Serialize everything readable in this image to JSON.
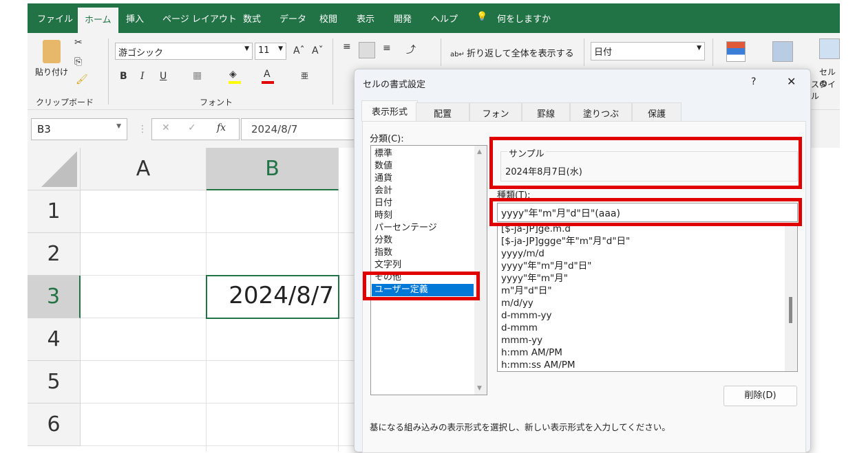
{
  "ribbon_tabs": [
    "ファイル",
    "ホーム",
    "挿入",
    "ページ レイアウト",
    "数式",
    "データ",
    "校閲",
    "表示",
    "開発",
    "ヘルプ"
  ],
  "active_tab": "ホーム",
  "tell_me": "何をしますか",
  "clipboard": {
    "paste": "貼り付け",
    "group": "クリップボード"
  },
  "font": {
    "name": "游ゴシック",
    "size": "11",
    "group": "フォント",
    "bold": "B",
    "italic": "I",
    "underline": "U",
    "font_color_letter": "A",
    "fill_color": "#ffff00",
    "font_color": "#e00000"
  },
  "alignment": {
    "wrap_text": "折り返して全体を表示する"
  },
  "number": {
    "format": "日付"
  },
  "styles": {
    "cell_styles_line1": "セルの",
    "cell_styles_line2": "スタイル"
  },
  "name_box": "B3",
  "formula": "2024/8/7",
  "fx": "fx",
  "columns": [
    "A",
    "B"
  ],
  "rows": [
    "1",
    "2",
    "3",
    "4",
    "5",
    "6"
  ],
  "cell_b3": "2024/8/7",
  "dialog": {
    "title": "セルの書式設定",
    "help": "?",
    "close": "✕",
    "tabs": [
      "表示形式",
      "配置",
      "フォント",
      "罫線",
      "塗りつぶし",
      "保護"
    ],
    "category_label": "分類(C):",
    "categories": [
      "標準",
      "数値",
      "通貨",
      "会計",
      "日付",
      "時刻",
      "パーセンテージ",
      "分数",
      "指数",
      "文字列",
      "その他",
      "ユーザー定義"
    ],
    "selected_category": "ユーザー定義",
    "sample_label": "サンプル",
    "sample_value": "2024年8月7日(水)",
    "type_label": "種類(T):",
    "type_value": "yyyy\"年\"m\"月\"d\"日\"(aaa)",
    "formats": [
      "[$-ja-JP]ge.m.d",
      "[$-ja-JP]ggge\"年\"m\"月\"d\"日\"",
      "yyyy/m/d",
      "yyyy\"年\"m\"月\"d\"日\"",
      "yyyy\"年\"m\"月\"",
      "m\"月\"d\"日\"",
      "m/d/yy",
      "d-mmm-yy",
      "d-mmm",
      "mmm-yy",
      "h:mm AM/PM",
      "h:mm:ss AM/PM"
    ],
    "delete_button": "削除(D)",
    "description": "基になる組み込みの表示形式を選択し、新しい表示形式を入力してください。"
  },
  "colors": {
    "excel_green": "#217346",
    "highlight": "#e00000",
    "selection": "#0078d7"
  }
}
